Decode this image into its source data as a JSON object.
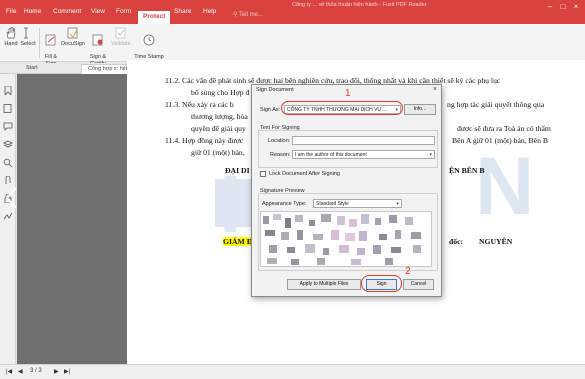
{
  "app": {
    "window_title": "Công ty ... về thỏa thuận hiện hành - Foxit PDF Reader"
  },
  "menu": {
    "items": [
      {
        "label": "File"
      },
      {
        "label": "Home"
      },
      {
        "label": "Comment"
      },
      {
        "label": "View"
      },
      {
        "label": "Form"
      },
      {
        "label": "Protect"
      },
      {
        "label": "Share"
      },
      {
        "label": "Help"
      }
    ],
    "search_placeholder": "Tell me..."
  },
  "ribbon": {
    "hand": "Hand",
    "select": "Select",
    "fill_sign": "Fill &\nSign",
    "docusign": "DocuSign",
    "sign_certify": "Sign &\nCertify",
    "validate": "Validate",
    "time_stamp": "Time Stamp\nDocument"
  },
  "tabs": {
    "start": "Start",
    "doc": "Công hợp x: hết chữ ng..."
  },
  "document": {
    "lines": [
      "11.2.  Các vấn đề phát sinh sẽ được hai bên nghiên cứu, trao đổi, thống nhất và khi cần thiết sẽ ký các phụ lục",
      "bổ sung cho Hợp đ",
      "11.3.  Nếu xảy ra các b",
      "thương lượng, hòa",
      "quyền để giải quy",
      "11.4.  Hợp đồng này được",
      "giữ 01 (một) bản,",
      "ĐẠI DI",
      "GIÁM Đ"
    ],
    "right_fragments": [
      "ng hợp tác giải quyết thông qua",
      "được sẽ đưa ra Toà án có thẩm",
      "Bên A giữ 01 (một) bản, Bên B",
      "ỆN BÊN B",
      "đốc:",
      "NGUYÊN"
    ]
  },
  "dialog": {
    "title": "Sign Document",
    "sign_as_label": "Sign As:",
    "sign_as_value": "CÔNG TY TNHH THƯƠNG MẠI DỊCH VỤ ...",
    "info_button": "Info...",
    "text_for_signing": "Text For Signing",
    "location_label": "Location:",
    "location_value": "",
    "reason_label": "Reason:",
    "reason_value": "I am the author of this document",
    "lock_label": "Lock Document After Signing",
    "signature_preview": "Signature Preview",
    "appearance_label": "Appearance Type:",
    "appearance_value": "Standard Style",
    "apply_button": "Apply to Multiple Files",
    "sign_button": "Sign",
    "cancel_button": "Cancel"
  },
  "annotations": {
    "step1": "1",
    "step2": "2"
  },
  "status": {
    "page": "3 / 3"
  },
  "colors": {
    "brand": "#d9423e",
    "annotation_red": "#e23a2e",
    "highlight": "#ffff00"
  }
}
